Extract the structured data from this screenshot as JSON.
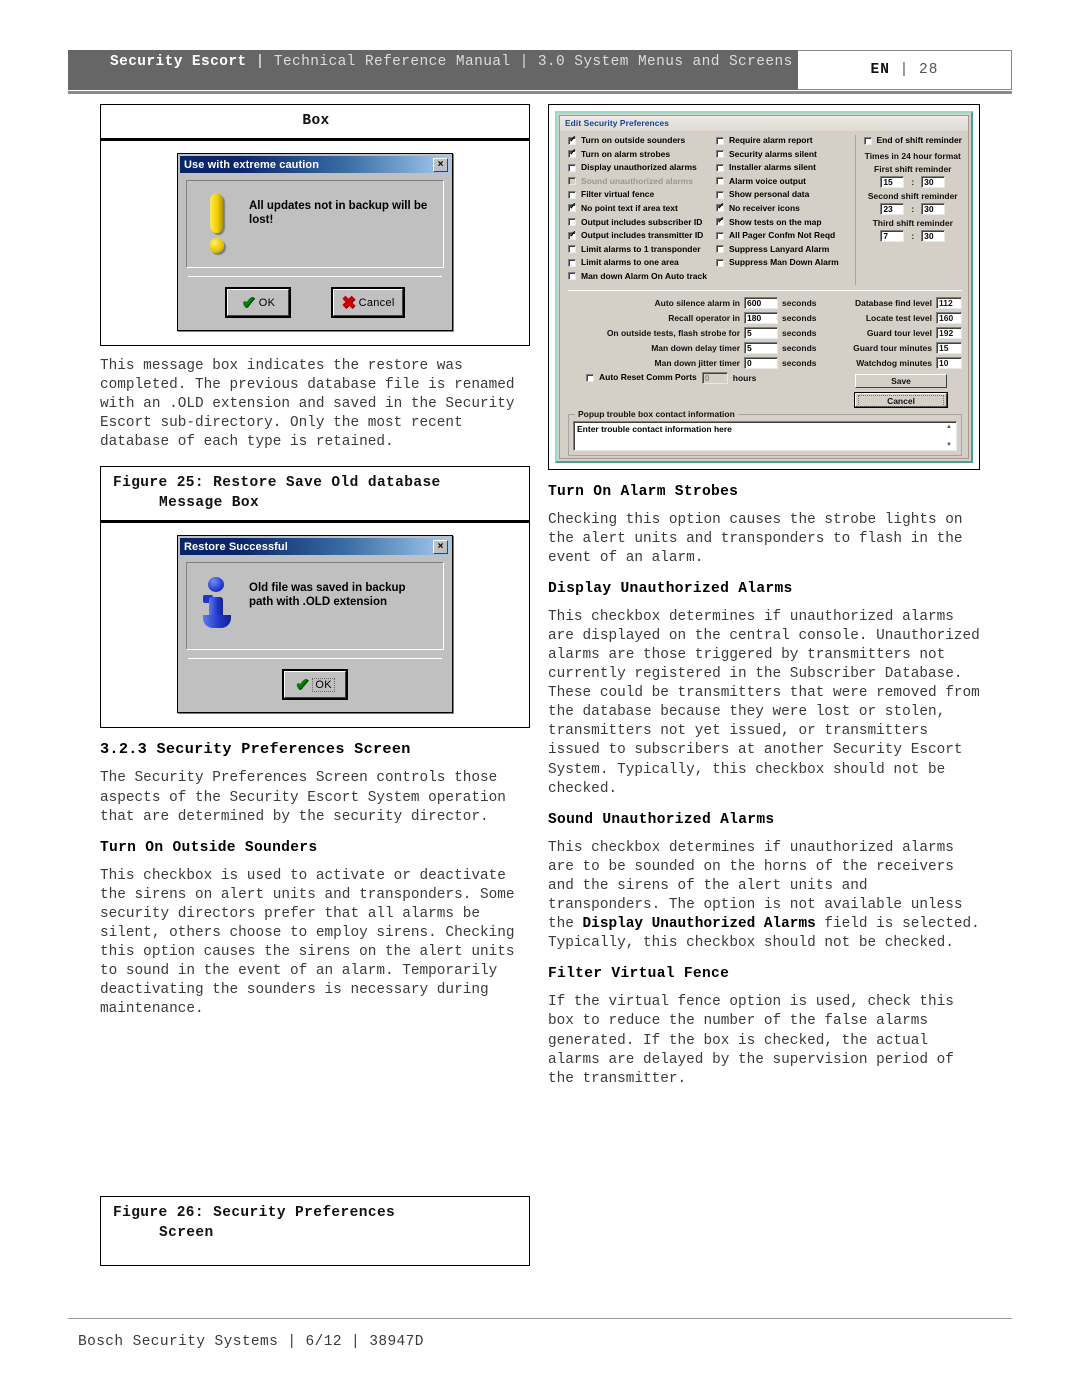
{
  "header": {
    "brand": "Security Escort",
    "sep1": "|",
    "manual": "Technical Reference Manual",
    "sep2": "|",
    "section": "3.0  System Menus and Screens",
    "lang": "EN",
    "sep3": "|",
    "page": "28"
  },
  "footer": {
    "text": "Bosch Security Systems | 6/12 | 38947D"
  },
  "left": {
    "fig24": {
      "caption": "Box",
      "dialog": {
        "title": "Use with extreme caution",
        "close": "×",
        "message": "All updates not in backup will be lost!",
        "ok": "OK",
        "cancel": "Cancel"
      }
    },
    "para_restore": "This message box indicates the restore was completed. The previous database file is renamed with an .OLD extension and saved in the Security Escort sub-directory. Only the most recent database of each type is retained.",
    "fig25": {
      "caption_line1": "Figure 25:  Restore Save Old database",
      "caption_line2": "Message Box",
      "dialog": {
        "title": "Restore Successful",
        "close": "×",
        "message": "Old file was saved in backup path with .OLD extension",
        "ok": "OK"
      }
    },
    "h_323": "3.2.3 Security Preferences Screen",
    "para_323": "The Security Preferences Screen controls those aspects of the Security Escort System operation that are determined by the security director.",
    "h_sounders": "Turn On Outside Sounders",
    "para_sounders": "This checkbox is used to activate or deactivate the sirens on alert units and transponders. Some security directors prefer that all alarms be silent, others choose to employ sirens. Checking this option causes the sirens on the alert units to sound in the event of an alarm. Temporarily deactivating the sounders is necessary during maintenance.",
    "fig26": {
      "caption_line1": "Figure 26:  Security Preferences",
      "caption_line2": "Screen"
    }
  },
  "prefs": {
    "title": "Edit Security Preferences",
    "col1": [
      {
        "label": "Turn on outside sounders",
        "checked": true,
        "disabled": false
      },
      {
        "label": "Turn on alarm strobes",
        "checked": true,
        "disabled": false
      },
      {
        "label": "Display unauthorized alarms",
        "checked": false,
        "disabled": false
      },
      {
        "label": "Sound unauthorized alarms",
        "checked": false,
        "disabled": true
      },
      {
        "label": "Filter virtual fence",
        "checked": false,
        "disabled": false
      },
      {
        "label": "No point text if area text",
        "checked": true,
        "disabled": false
      },
      {
        "label": "Output includes subscriber ID",
        "checked": false,
        "disabled": false
      },
      {
        "label": "Output includes transmitter ID",
        "checked": true,
        "disabled": false
      },
      {
        "label": "Limit alarms to 1 transponder",
        "checked": false,
        "disabled": false
      },
      {
        "label": "Limit alarms to one area",
        "checked": false,
        "disabled": false
      },
      {
        "label": "Man down Alarm On Auto track",
        "checked": false,
        "disabled": false
      }
    ],
    "col2": [
      {
        "label": "Require alarm report",
        "checked": false,
        "disabled": false
      },
      {
        "label": "Security alarms silent",
        "checked": false,
        "disabled": false
      },
      {
        "label": "Installer alarms silent",
        "checked": false,
        "disabled": false
      },
      {
        "label": "Alarm voice output",
        "checked": false,
        "disabled": false
      },
      {
        "label": "Show personal data",
        "checked": false,
        "disabled": false
      },
      {
        "label": "No receiver icons",
        "checked": true,
        "disabled": false
      },
      {
        "label": "Show tests on the map",
        "checked": true,
        "disabled": false
      },
      {
        "label": "All Pager Confm Not Reqd",
        "checked": false,
        "disabled": false
      },
      {
        "label": "Suppress Lanyard Alarm",
        "checked": false,
        "disabled": false
      },
      {
        "label": "Suppress Man Down Alarm",
        "checked": false,
        "disabled": false
      }
    ],
    "shift": {
      "end_of_shift_label": "End of shift reminder",
      "end_of_shift_checked": false,
      "format_note": "Times in 24 hour format",
      "first_label": "First shift reminder",
      "first_hh": "15",
      "first_mm": "30",
      "second_label": "Second shift reminder",
      "second_hh": "23",
      "second_mm": "30",
      "third_label": "Third shift reminder",
      "third_hh": "7",
      "third_mm": "30",
      "colon": ":"
    },
    "timers": [
      {
        "label": "Auto silence alarm in",
        "value": "600",
        "unit": "seconds"
      },
      {
        "label": "Recall operator in",
        "value": "180",
        "unit": "seconds"
      },
      {
        "label": "On outside tests, flash strobe for",
        "value": "5",
        "unit": "seconds"
      },
      {
        "label": "Man down delay timer",
        "value": "5",
        "unit": "seconds"
      },
      {
        "label": "Man down jitter timer",
        "value": "0",
        "unit": "seconds"
      }
    ],
    "auto_reset": {
      "label": "Auto Reset Comm Ports",
      "checked": false,
      "value": "0",
      "unit": "hours"
    },
    "levels": [
      {
        "label": "Database find level",
        "value": "112"
      },
      {
        "label": "Locate test level",
        "value": "160"
      },
      {
        "label": "Guard tour level",
        "value": "192"
      },
      {
        "label": "Guard tour minutes",
        "value": "15"
      },
      {
        "label": "Watchdog minutes",
        "value": "10"
      }
    ],
    "save_label": "Save",
    "cancel_label": "Cancel",
    "popup_group_label": "Popup trouble box contact information",
    "popup_text": "Enter trouble contact information here"
  },
  "right": {
    "h_strobes": "Turn On Alarm Strobes",
    "para_strobes": "Checking this option causes the strobe lights on the alert units and transponders to flash in the event of an alarm.",
    "h_display": "Display Unauthorized Alarms",
    "para_display": "This checkbox determines if unauthorized alarms are displayed on the central console. Unauthorized alarms are those triggered by transmitters not currently registered in the Subscriber Database. These could be transmitters that were removed from the database because they were lost or stolen, transmitters not yet issued, or transmitters issued to subscribers at another Security Escort System. Typically, this checkbox should not be checked.",
    "h_sound": "Sound Unauthorized Alarms",
    "para_sound_1": "This checkbox determines if unauthorized alarms are to be sounded on the horns of the receivers and the sirens of the alert units and transponders. The option is not available unless the ",
    "para_sound_b1": "Display Unauthorized Alarms",
    "para_sound_2": " field is selected. Typically, this checkbox should not be checked.",
    "h_filter": "Filter Virtual Fence",
    "para_filter": "If the virtual fence option is used, check this box to reduce the number of the false alarms generated. If the box is checked, the actual alarms are delayed by the supervision period of the transmitter."
  }
}
